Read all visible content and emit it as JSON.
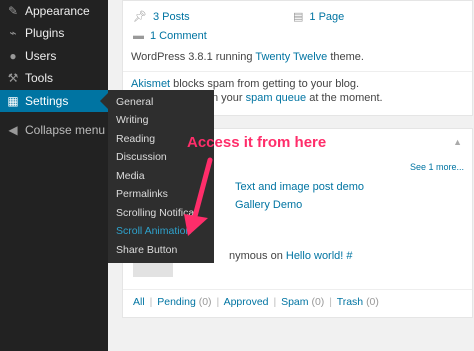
{
  "sidebar": {
    "items": [
      {
        "label": "Appearance",
        "icon": "brush-icon"
      },
      {
        "label": "Plugins",
        "icon": "plug-icon"
      },
      {
        "label": "Users",
        "icon": "users-icon"
      },
      {
        "label": "Tools",
        "icon": "wrench-icon"
      },
      {
        "label": "Settings",
        "icon": "settings-icon"
      }
    ],
    "collapse_label": "Collapse menu"
  },
  "flyout": {
    "items": [
      "General",
      "Writing",
      "Reading",
      "Discussion",
      "Media",
      "Permalinks",
      "Scrolling Notificat",
      "Scroll Animation",
      "Share Button"
    ]
  },
  "glance": {
    "posts": "3 Posts",
    "pages": "1 Page",
    "comments": "1 Comment",
    "version_prefix": "WordPress 3.8.1 running ",
    "theme": "Twenty Twelve",
    "version_suffix": " theme.",
    "akismet": "Akismet",
    "akismet_text": " blocks spam from getting to your blog.",
    "spam_prefix": "There's nothing in your ",
    "spam_queue": "spam queue",
    "spam_suffix": " at the moment."
  },
  "activity": {
    "see_more": "See 1 more...",
    "posts": [
      "Text and image post demo",
      "Gallery Demo"
    ],
    "comment_prefix": "nymous on ",
    "comment_link": "Hello world! #",
    "filters": {
      "all": "All",
      "pending": "Pending",
      "pending_count": "(0)",
      "approved": "Approved",
      "spam": "Spam",
      "spam_count": "(0)",
      "trash": "Trash",
      "trash_count": "(0)",
      "sep": "|"
    }
  },
  "annotation": {
    "text": "Access it from here",
    "color": "#ff2d6a"
  },
  "colors": {
    "sidebar": "#222222",
    "active": "#0074a2",
    "link": "#0074a2",
    "flyout": "#2e2e2e"
  }
}
